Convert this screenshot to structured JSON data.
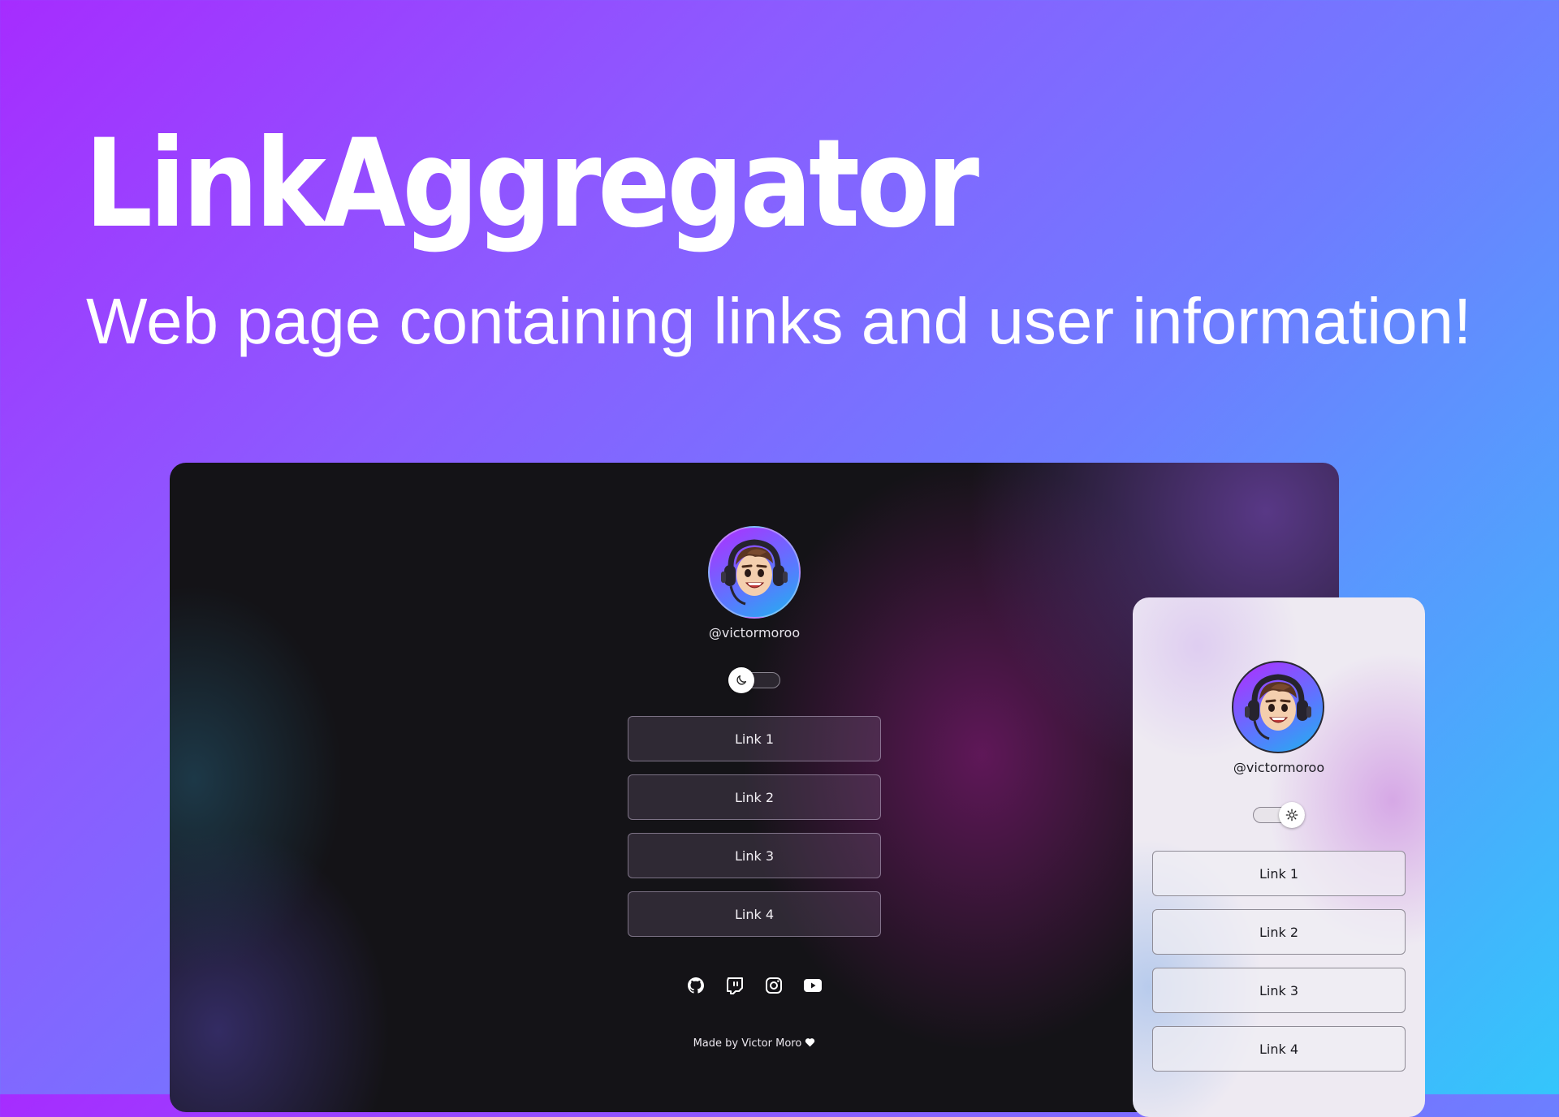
{
  "hero": {
    "title": "LinkAggregator",
    "subtitle": "Web page containing links and user information!"
  },
  "dark_preview": {
    "username": "@victormoroo",
    "theme_toggle": {
      "knob_icon": "moon-icon",
      "mode": "dark"
    },
    "links": [
      {
        "label": "Link 1"
      },
      {
        "label": "Link 2"
      },
      {
        "label": "Link 3"
      },
      {
        "label": "Link 4"
      }
    ],
    "social_icons": [
      "github-icon",
      "twitch-icon",
      "instagram-icon",
      "youtube-icon"
    ],
    "footer": "Made by Victor Moro"
  },
  "light_preview": {
    "username": "@victormoroo",
    "theme_toggle": {
      "knob_icon": "sun-icon",
      "mode": "light"
    },
    "links": [
      {
        "label": "Link 1"
      },
      {
        "label": "Link 2"
      },
      {
        "label": "Link 3"
      },
      {
        "label": "Link 4"
      }
    ]
  },
  "colors": {
    "background_start": "#a62cff",
    "background_end": "#34c6fb",
    "dark_surface": "#141317",
    "light_surface": "#eeeaf2"
  }
}
